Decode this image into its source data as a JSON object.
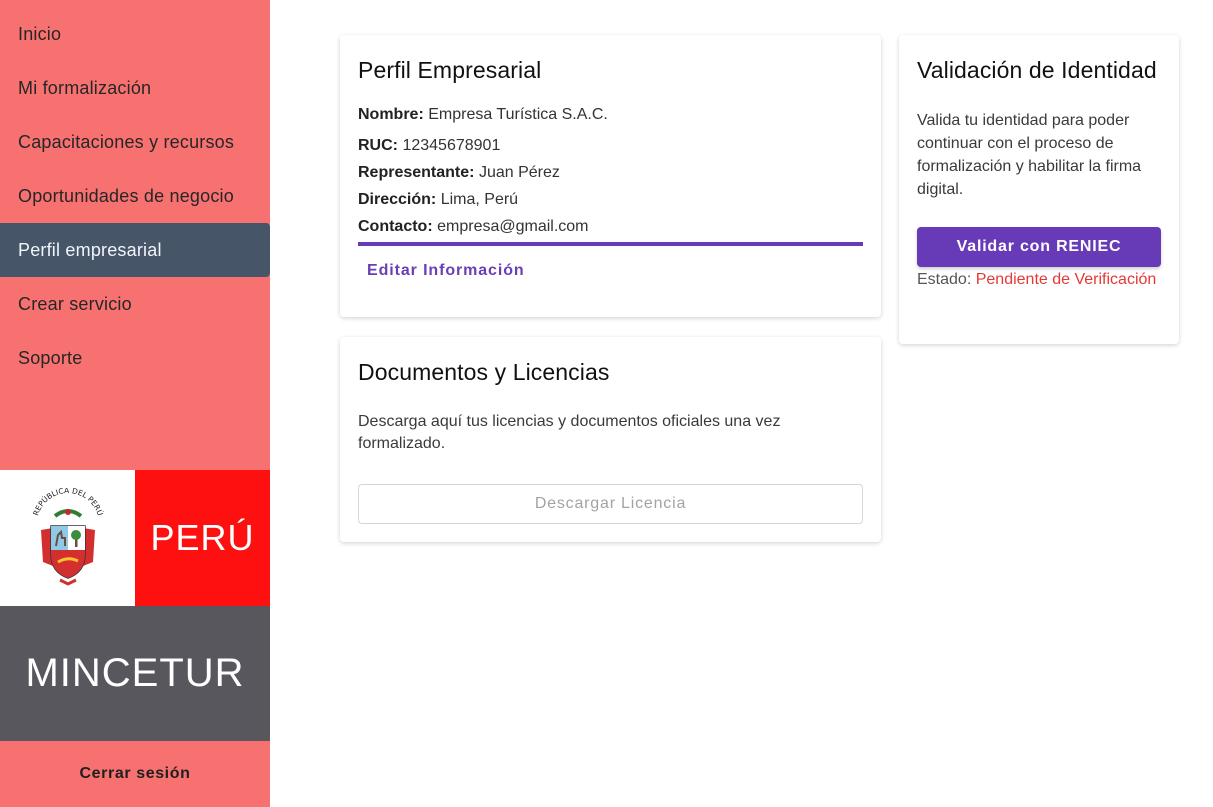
{
  "sidebar": {
    "items": [
      {
        "label": "Inicio",
        "active": false
      },
      {
        "label": "Mi formalización",
        "active": false
      },
      {
        "label": "Capacitaciones y recursos",
        "active": false
      },
      {
        "label": "Oportunidades de negocio",
        "active": false
      },
      {
        "label": "Perfil empresarial",
        "active": true
      },
      {
        "label": "Crear servicio",
        "active": false
      },
      {
        "label": "Soporte",
        "active": false
      }
    ],
    "logo": {
      "emblem": "peru-coat-of-arms-icon",
      "emblem_text": "REPÚBLICA DEL PERÚ",
      "country": "PERÚ",
      "ministry": "MINCETUR"
    },
    "logout_label": "Cerrar sesión"
  },
  "profile_card": {
    "title": "Perfil Empresarial",
    "fields": [
      {
        "label": "Nombre:",
        "value": "Empresa Turística S.A.C."
      },
      {
        "label": "RUC:",
        "value": "12345678901"
      },
      {
        "label": "Representante:",
        "value": "Juan Pérez"
      },
      {
        "label": "Dirección:",
        "value": "Lima, Perú"
      },
      {
        "label": "Contacto:",
        "value": "empresa@gmail.com"
      }
    ],
    "edit_label": "Editar Información"
  },
  "docs_card": {
    "title": "Documentos y Licencias",
    "description": "Descarga aquí tus licencias y documentos oficiales una vez formalizado.",
    "download_label": "Descargar Licencia"
  },
  "identity_card": {
    "title": "Validación de Identidad",
    "description": "Valida tu identidad para poder continuar con el proceso de formalización y habilitar la firma digital.",
    "validate_label": "Validar con RENIEC",
    "status_label": "Estado:",
    "status_value": "Pendiente de Verificación"
  },
  "colors": {
    "sidebar": "#f87171",
    "active_item": "#475569",
    "primary": "#673ab7",
    "peru_red": "#ff1010",
    "mincetur_gray": "#57575d",
    "pending": "#e53935"
  }
}
